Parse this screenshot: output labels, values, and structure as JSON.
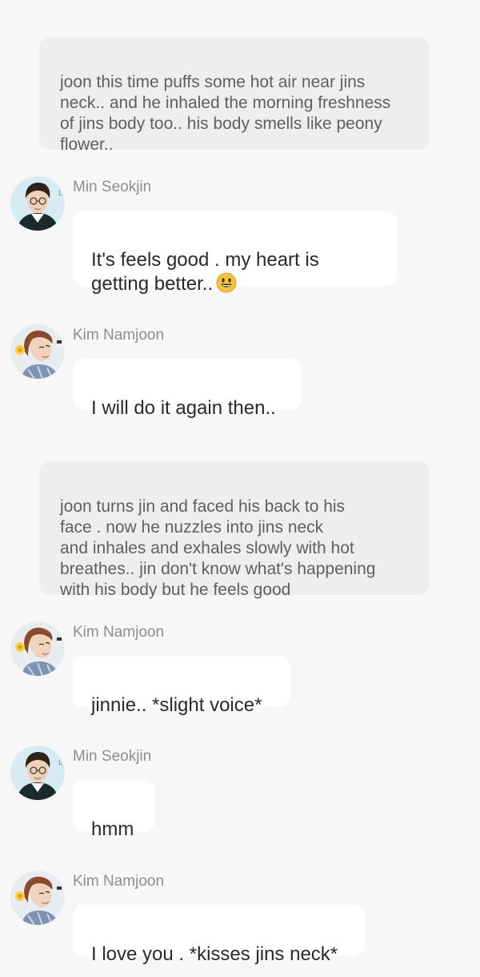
{
  "narrations": [
    {
      "text": "joon this time puffs some hot air near jins\nneck.. and he inhaled the morning freshness\nof jins body too.. his body smells like peony\nflower.."
    },
    {
      "text": "joon turns jin and faced his back to his\nface . now he nuzzles into jins neck\nand inhales and exhales slowly with hot\nbreathes.. jin don't know what's happening\nwith his body but he feels good"
    }
  ],
  "messages": [
    {
      "sender": "Min Seokjin",
      "text": "It's feels good . my heart is\ngetting better..",
      "emoji": "smiling-face-emoji",
      "avatar": "seokjin-avatar"
    },
    {
      "sender": "Kim Namjoon",
      "text": "I will do it again then..",
      "avatar": "namjoon-avatar"
    },
    {
      "sender": "Kim Namjoon",
      "text": "jinnie.. *slight voice*",
      "avatar": "namjoon-avatar"
    },
    {
      "sender": "Min Seokjin",
      "text": "hmm",
      "avatar": "seokjin-avatar"
    },
    {
      "sender": "Kim Namjoon",
      "text": "I love you . *kisses jins neck*",
      "avatar": "namjoon-avatar"
    }
  ],
  "colors": {
    "background": "#f7f7f7",
    "narration_bg": "#eeeeee",
    "bubble_bg": "#ffffff",
    "sender_text": "#8e8e8e",
    "message_text": "#2a2a2a",
    "emoji": "#f5c33b"
  }
}
